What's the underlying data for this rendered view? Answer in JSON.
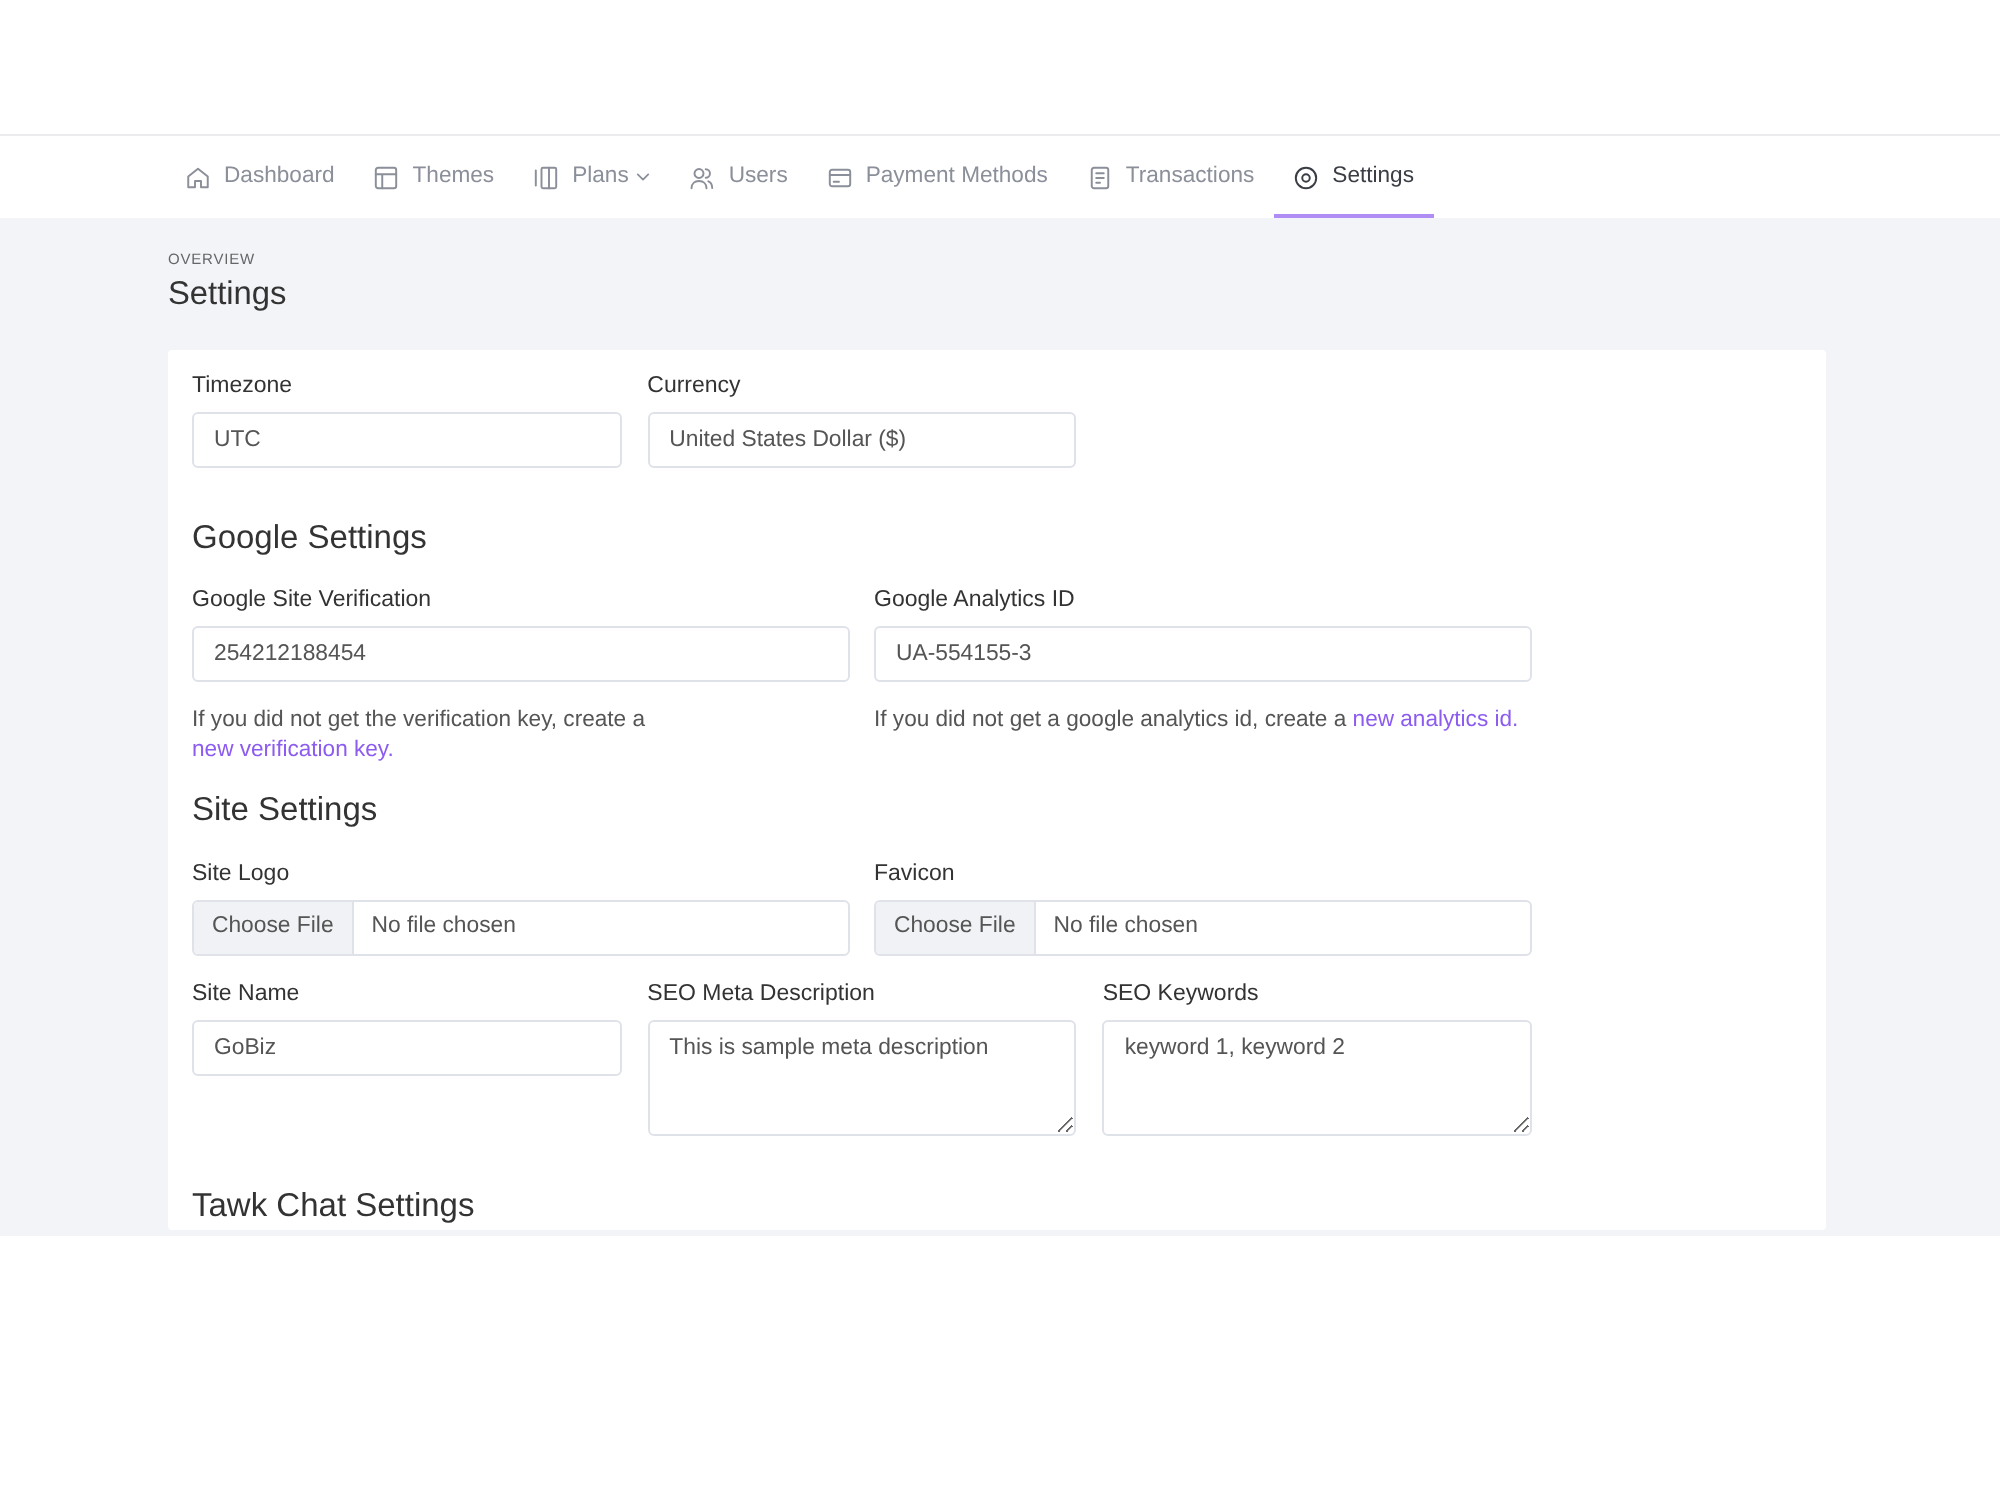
{
  "nav": {
    "items": [
      {
        "label": "Dashboard",
        "selected": false,
        "dropdown": false
      },
      {
        "label": "Themes",
        "selected": false,
        "dropdown": false
      },
      {
        "label": "Plans",
        "selected": false,
        "dropdown": true
      },
      {
        "label": "Users",
        "selected": false,
        "dropdown": false
      },
      {
        "label": "Payment Methods",
        "selected": false,
        "dropdown": false
      },
      {
        "label": "Transactions",
        "selected": false,
        "dropdown": false
      },
      {
        "label": "Settings",
        "selected": true,
        "dropdown": false
      }
    ]
  },
  "page": {
    "eyebrow": "OVERVIEW",
    "title": "Settings"
  },
  "general": [
    {
      "label": "Timezone",
      "value": "UTC"
    },
    {
      "label": "Currency",
      "value": "United States Dollar ($)"
    }
  ],
  "google_settings": {
    "heading": "Google Settings",
    "fields": [
      {
        "label": "Google Site Verification",
        "value": "254212188454",
        "help": "If you did not get the verification key, create a ",
        "link": "new verification key."
      },
      {
        "label": "Google Analytics ID",
        "value": "UA-554155-3",
        "help": "If you did not get a google analytics id, create a ",
        "link": "new analytics id."
      }
    ]
  },
  "site_settings": {
    "heading": "Site Settings",
    "uploads": [
      {
        "label": "Site Logo",
        "button": "Choose File",
        "status": "No file chosen"
      },
      {
        "label": "Favicon",
        "button": "Choose File",
        "status": "No file chosen"
      }
    ],
    "fields": [
      {
        "kind": "input",
        "label": "Site Name",
        "value": "GoBiz"
      },
      {
        "kind": "textarea",
        "label": "SEO Meta Description",
        "value": "This is sample meta description"
      },
      {
        "kind": "textarea",
        "label": "SEO Keywords",
        "value": "keyword 1, keyword 2"
      }
    ]
  },
  "tawk_chat_settings": {
    "heading": "Tawk Chat Settings"
  }
}
